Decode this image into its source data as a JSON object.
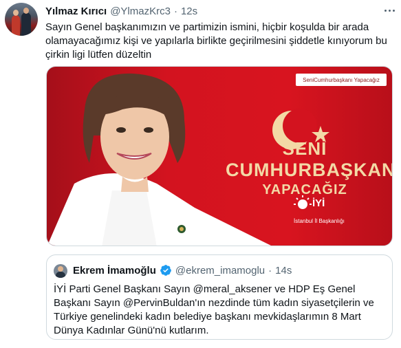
{
  "tweet": {
    "author_name": "Yılmaz Kırıcı",
    "author_handle": "@YlmazKrc3",
    "separator": "·",
    "timestamp": "12s",
    "text": "Sayın Genel başkanımızın ve partimizin ismini, hiçbir koşulda bir arada olamayacağımız kişi ve yapılarla birlikte geçirilmesini şiddetle kınıyorum bu çirkin ligi lütfen düzeltin",
    "more_icon": "more-horizontal-icon"
  },
  "media": {
    "hashtag": "SeniCumhurbaşkanı Yapacağız",
    "slogan_line1": "SENİ",
    "slogan_line2": "CUMHURBAŞKANI",
    "slogan_line3": "YAPACAĞIZ",
    "party_name": "İYİ",
    "party_sub": "İstanbul İl Başkanlığı",
    "background_color": "#d3131f",
    "slogan_color": "#f3d9a6"
  },
  "quoted_tweet": {
    "author_name": "Ekrem İmamoğlu",
    "verified": true,
    "author_handle": "@ekrem_imamoglu",
    "separator": "·",
    "timestamp": "14s",
    "text": "İYİ Parti Genel Başkanı Sayın @meral_aksener ve HDP Eş Genel Başkanı Sayın @PervinBuldan'ın nezdinde tüm kadın siyasetçilerin ve Türkiye genelindeki kadın belediye başkanı mevkidaşlarımın 8 Mart Dünya Kadınlar Günü'nü kutlarım.",
    "verified_color": "#1d9bf0"
  }
}
